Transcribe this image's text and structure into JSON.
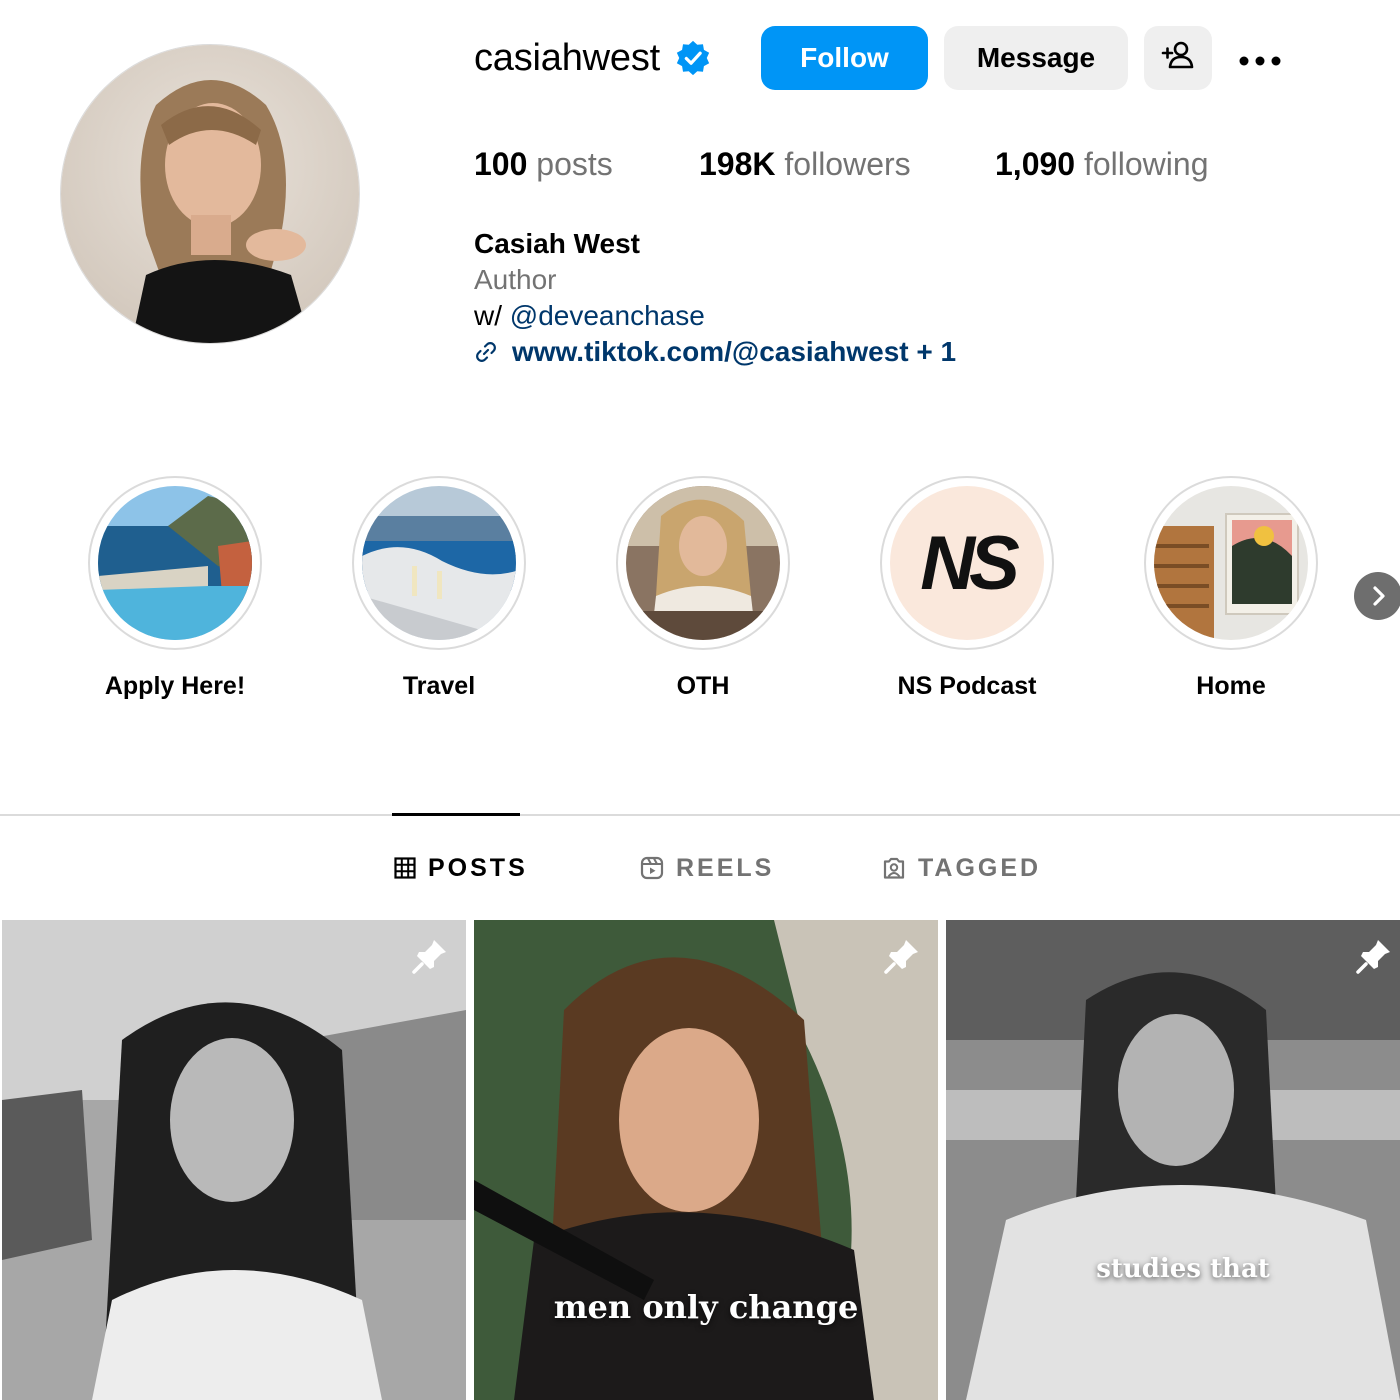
{
  "profile": {
    "username": "casiahwest",
    "verified": true,
    "follow_label": "Follow",
    "message_label": "Message",
    "stats": {
      "posts_count": "100",
      "posts_label": "posts",
      "followers_count": "198K",
      "followers_label": "followers",
      "following_count": "1,090",
      "following_label": "following"
    },
    "bio": {
      "name": "Casiah West",
      "category": "Author",
      "prefix": "w/",
      "mention": "@deveanchase",
      "link_text": "www.tiktok.com/@casiahwest + 1"
    }
  },
  "highlights": [
    {
      "label": "Apply Here!"
    },
    {
      "label": "Travel"
    },
    {
      "label": "OTH"
    },
    {
      "label": "NS Podcast",
      "logo_text": "NS"
    },
    {
      "label": "Home"
    }
  ],
  "tabs": [
    {
      "label": "POSTS",
      "active": true
    },
    {
      "label": "REELS",
      "active": false
    },
    {
      "label": "TAGGED",
      "active": false
    }
  ],
  "posts": [
    {
      "caption": "",
      "pinned": true
    },
    {
      "caption": "men only change",
      "pinned": true
    },
    {
      "caption": "studies that",
      "pinned": true
    }
  ],
  "colors": {
    "accent": "#0095f6",
    "verified": "#0095f6",
    "link": "#00376b",
    "secondary_text": "#737373",
    "button_gray": "#efefef"
  }
}
